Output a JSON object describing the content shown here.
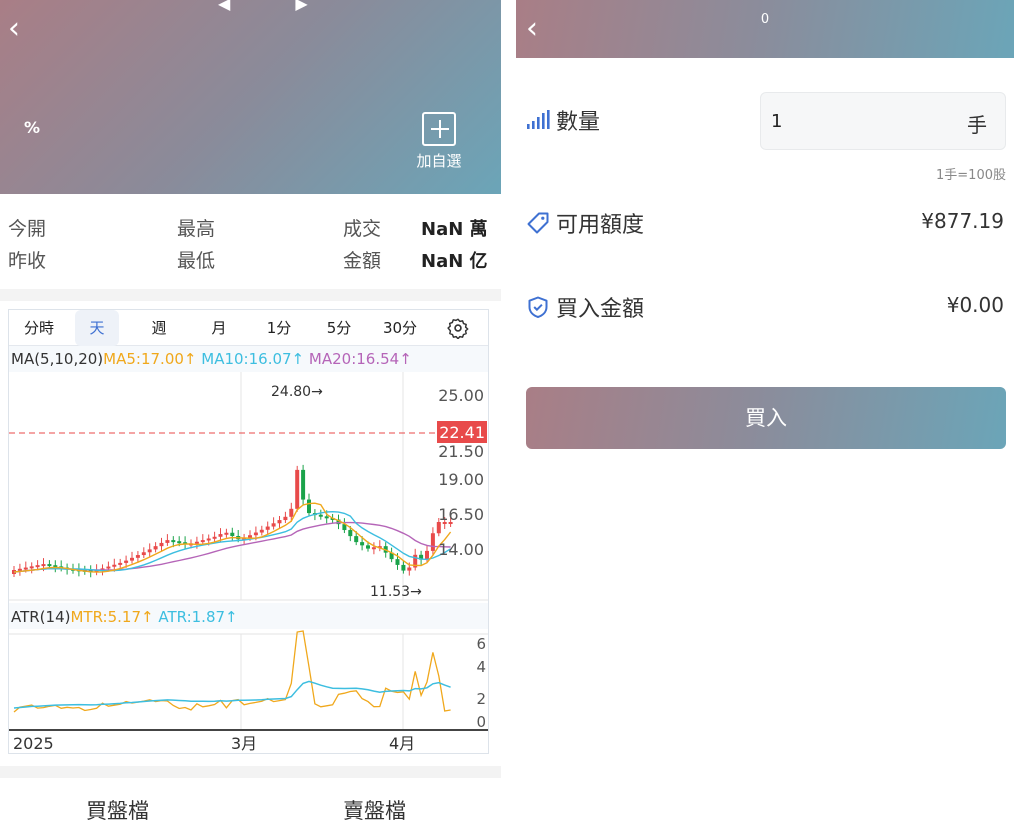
{
  "left": {
    "hero": {
      "back_icon": "chevron-left-icon",
      "top_glyphs": "◀ ▶",
      "percent": "%",
      "add_fav_label": "加自選"
    },
    "stats": {
      "open_label": "今開",
      "high_label": "最高",
      "volume_label": "成交",
      "volume_value": "NaN 萬",
      "prev_close_label": "昨收",
      "low_label": "最低",
      "amount_label": "金額",
      "amount_value": "NaN 亿"
    },
    "tabs": [
      "分時",
      "天",
      "週",
      "月",
      "1分",
      "5分",
      "30分"
    ],
    "active_tab": "天",
    "settings_icon": "gear-icon",
    "ma": {
      "name": "MA(5,10,20)",
      "ma5": "MA5:17.00↑",
      "ma10": "MA10:16.07↑",
      "ma20": "MA20:16.54↑"
    },
    "atr": {
      "name": "ATR(14)",
      "mtr": "MTR:5.17↑",
      "atr": "ATR:1.87↑"
    },
    "price_axis": [
      "25.00",
      "21.50",
      "19.00",
      "16.50",
      "14.00"
    ],
    "current_price": "22.41",
    "high_marker": "24.80→",
    "low_marker": "11.53→",
    "atr_axis": [
      "6",
      "4",
      "2",
      "0"
    ],
    "time_axis": [
      "2025",
      "3月",
      "4月"
    ],
    "bottom_tabs": [
      "買盤檔",
      "賣盤檔"
    ]
  },
  "right": {
    "header": {
      "back_icon": "chevron-left-icon",
      "title": "0"
    },
    "quantity": {
      "label": "數量",
      "value": "1",
      "unit": "手",
      "hint": "1手=100股"
    },
    "available": {
      "label": "可用額度",
      "value": "¥877.19"
    },
    "buy_amount": {
      "label": "買入金額",
      "value": "¥0.00"
    },
    "buy_button": "買入"
  },
  "colors": {
    "up": "#e84a4a",
    "down": "#1aa34a",
    "ma5": "#f0a81c",
    "ma10": "#3dbee0",
    "ma20": "#b565b8",
    "accent": "#3f71d2"
  }
}
